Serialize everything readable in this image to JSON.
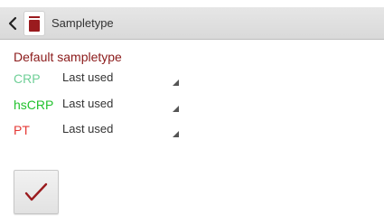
{
  "action_bar": {
    "title": "Sampletype",
    "back_icon": "chevron-left-icon",
    "app_icon": "sample-tube-icon"
  },
  "section": {
    "title": "Default sampletype"
  },
  "rows": [
    {
      "label": "CRP",
      "label_color": "#6fcf97",
      "value": "Last used"
    },
    {
      "label": "hsCRP",
      "label_color": "#22c22e",
      "value": "Last used"
    },
    {
      "label": "PT",
      "label_color": "#e53935",
      "value": "Last used"
    }
  ],
  "confirm_button": {
    "icon": "checkmark-icon",
    "icon_color": "#9a1b1e"
  }
}
